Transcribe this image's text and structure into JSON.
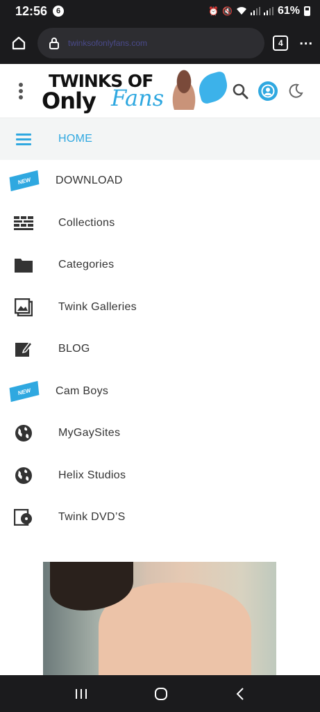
{
  "status_bar": {
    "time": "12:56",
    "notification_count": "6",
    "battery": "61%"
  },
  "browser": {
    "url": "twinksofonlyfans.com",
    "tab_count": "4"
  },
  "site": {
    "logo_top": "TWINKS OF",
    "logo_only": "Only",
    "logo_fans": "Fans",
    "accent_color": "#2fa8e0"
  },
  "menu": {
    "home_label": "HOME",
    "new_badge": "NEW",
    "items": [
      {
        "label": "DOWNLOAD",
        "icon": "new-badge"
      },
      {
        "label": "Collections",
        "icon": "grid-icon"
      },
      {
        "label": "Categories",
        "icon": "folder-icon"
      },
      {
        "label": "Twink Galleries",
        "icon": "gallery-icon"
      },
      {
        "label": "BLOG",
        "icon": "edit-icon"
      },
      {
        "label": "Cam Boys",
        "icon": "new-badge"
      },
      {
        "label": "MyGaySites",
        "icon": "globe-icon"
      },
      {
        "label": "Helix Studios",
        "icon": "globe-icon"
      },
      {
        "label": "Twink DVD’S",
        "icon": "dvd-icon"
      }
    ]
  }
}
